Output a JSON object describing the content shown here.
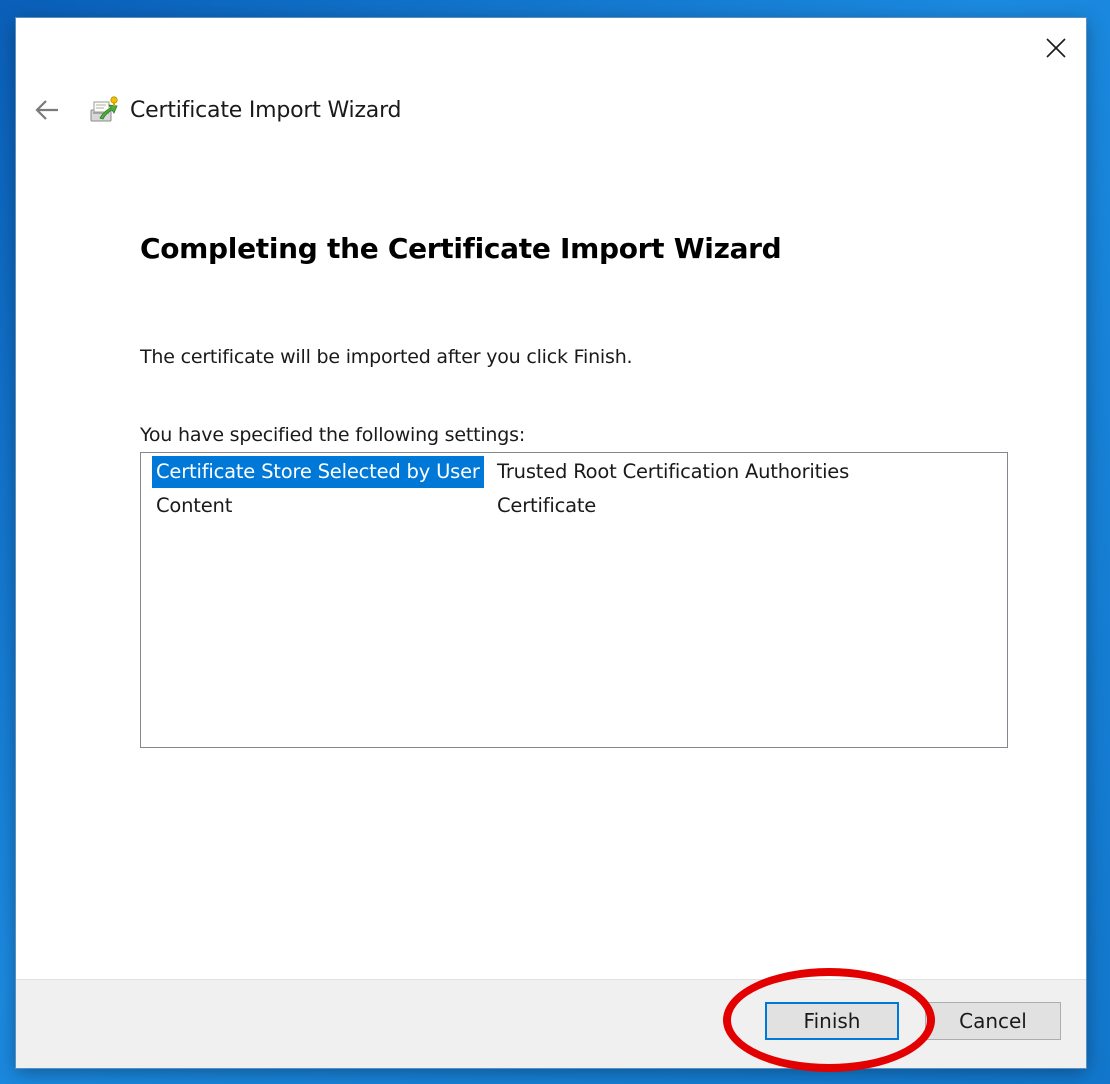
{
  "window": {
    "title": "Certificate Import Wizard"
  },
  "icons": {
    "close": "close-icon",
    "back": "back-arrow-icon",
    "wizard": "certificate-wizard-icon"
  },
  "page": {
    "heading": "Completing the Certificate Import Wizard",
    "description": "The certificate will be imported after you click Finish.",
    "settings_label": "You have specified the following settings:"
  },
  "settings": {
    "rows": [
      {
        "name": "Certificate Store Selected by User",
        "value": "Trusted Root Certification Authorities",
        "selected": true
      },
      {
        "name": "Content",
        "value": "Certificate",
        "selected": false
      }
    ]
  },
  "footer": {
    "finish_label": "Finish",
    "cancel_label": "Cancel"
  },
  "colors": {
    "selection": "#0078d7",
    "annotation": "#e20000",
    "footer_bg": "#f0f0f0"
  }
}
